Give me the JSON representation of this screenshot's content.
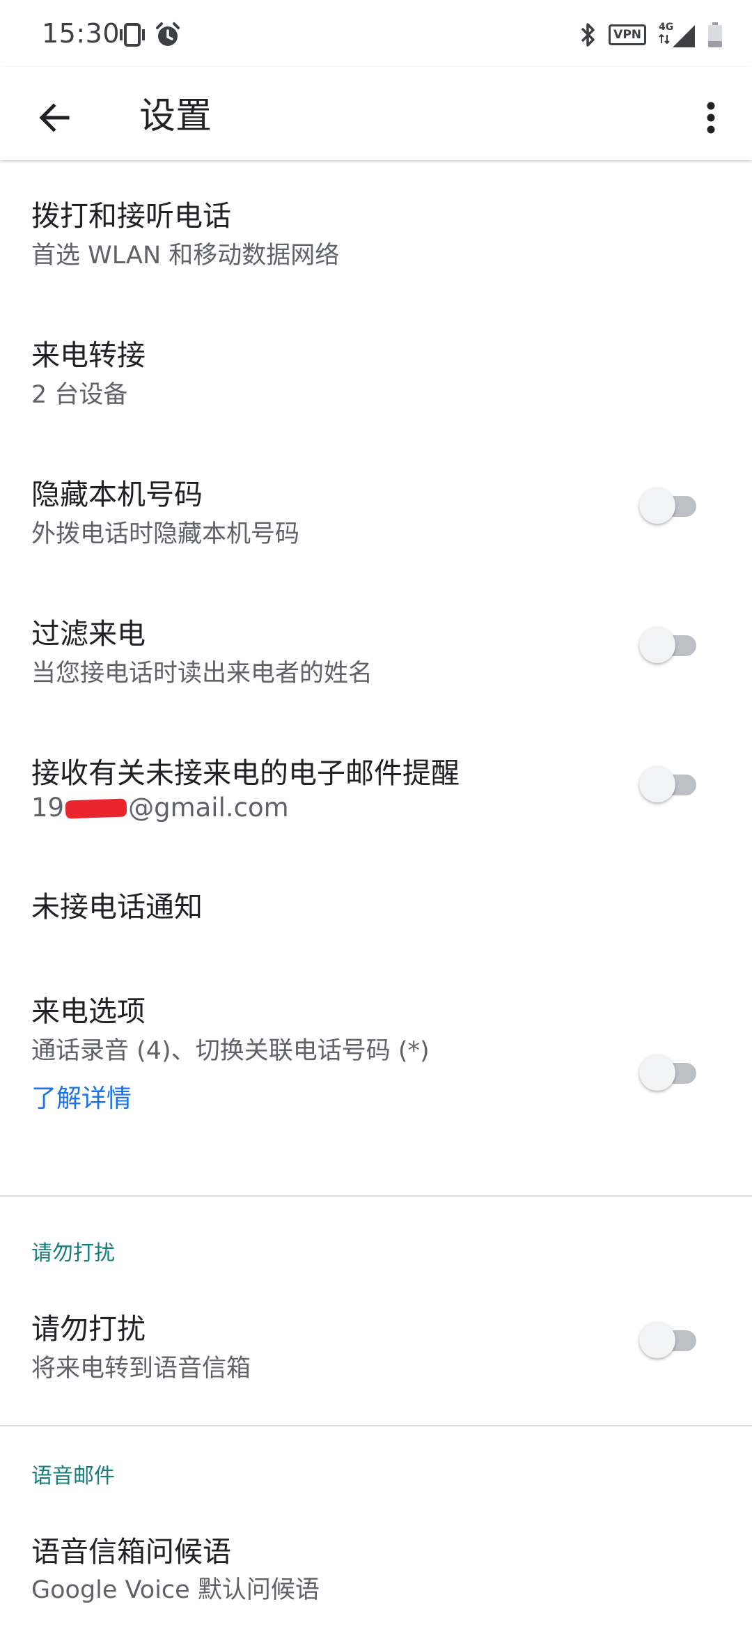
{
  "status_bar": {
    "time": "15:30",
    "left_icons": [
      "vibrate-icon",
      "alarm-icon"
    ],
    "right_icons": [
      "bluetooth-icon",
      "vpn-icon",
      "mobile-signal-icon",
      "battery-icon"
    ],
    "vpn_label": "VPN",
    "network_label": "4G"
  },
  "app_bar": {
    "title": "设置",
    "back_icon": "arrow-back-icon",
    "more_icon": "more-vert-icon"
  },
  "settings": {
    "calls": {
      "title": "拨打和接听电话",
      "subtitle": "首选 WLAN 和移动数据网络"
    },
    "forwarding": {
      "title": "来电转接",
      "subtitle": "2 台设备"
    },
    "hide_number": {
      "title": "隐藏本机号码",
      "subtitle": "外拨电话时隐藏本机号码",
      "enabled": false
    },
    "screen_calls": {
      "title": "过滤来电",
      "subtitle": "当您接电话时读出来电者的姓名",
      "enabled": false
    },
    "missed_email": {
      "title": "接收有关未接来电的电子邮件提醒",
      "email_prefix": "19",
      "email_suffix": "@gmail.com",
      "enabled": false
    },
    "missed_notification": {
      "title": "未接电话通知"
    },
    "incoming_options": {
      "title": "来电选项",
      "subtitle": "通话录音 (4)、切换关联电话号码 (*)",
      "link": "了解详情",
      "enabled": false
    }
  },
  "dnd_section": {
    "header": "请勿打扰",
    "item": {
      "title": "请勿打扰",
      "subtitle": "将来电转到语音信箱",
      "enabled": false
    }
  },
  "voicemail_section": {
    "header": "语音邮件",
    "item": {
      "title": "语音信箱问候语",
      "subtitle": "Google Voice 默认问候语"
    }
  },
  "colors": {
    "accent_link": "#1a73e8",
    "section_header": "#137e7a",
    "redaction": "#e8262c"
  }
}
